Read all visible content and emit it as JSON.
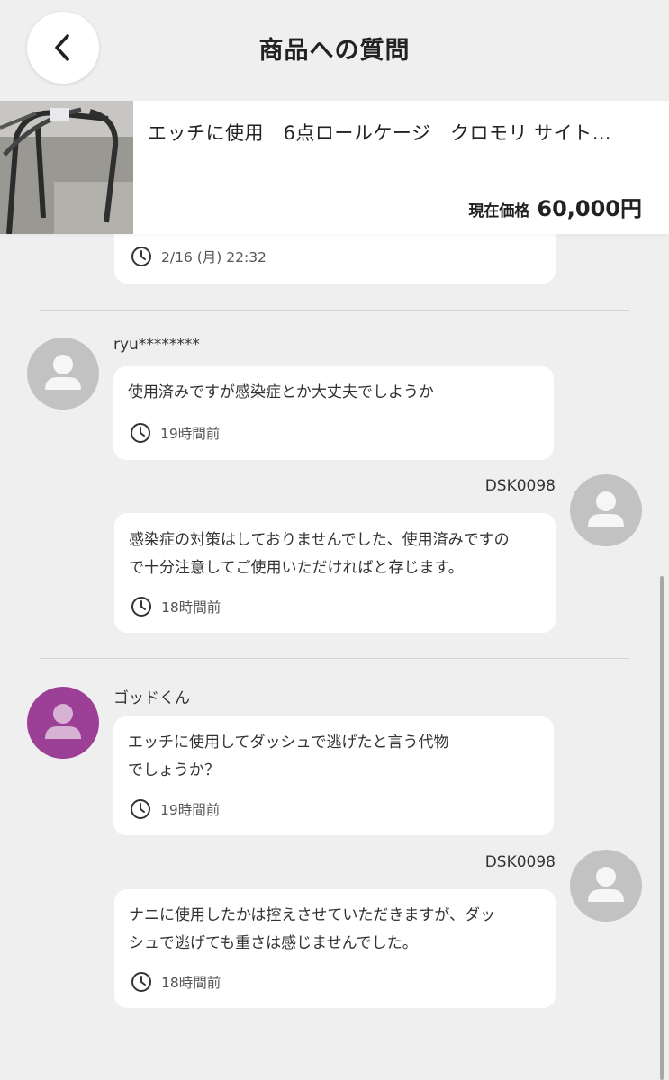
{
  "header": {
    "title": "商品への質問"
  },
  "product": {
    "title": "エッチに使用　6点ロールケージ　クロモリ サイト…",
    "price_label": "現在価格",
    "price": "60,000円"
  },
  "first_bubble": {
    "time": "2/16 (月) 22:32"
  },
  "thread1": {
    "question": {
      "user": "ryu********",
      "message": "使用済みですが感染症とか大丈夫でしようか",
      "time": "19時間前"
    },
    "answer": {
      "user": "DSK0098",
      "message": "感染症の対策はしておりませんでした、使用済みですの\nで十分注意してご使用いただければと存じます。",
      "time": "18時間前"
    }
  },
  "thread2": {
    "question": {
      "user": "ゴッドくん",
      "message": "エッチに使用してダッシュで逃げたと言う代物\nでしょうか？",
      "time": "19時間前"
    },
    "answer": {
      "user": "DSK0098",
      "message": "ナニに使用したかは控えさせていただきますが、ダッ\nシュで逃げても重さは感じませんでした。",
      "time": "18時間前"
    }
  },
  "icons": {
    "back": "chevron-left-icon",
    "clock": "clock-icon",
    "avatar": "person-icon"
  },
  "colors": {
    "background": "#efefef",
    "avatar_gray": "#c2c2c2",
    "avatar_purple": "#9c3f97"
  }
}
